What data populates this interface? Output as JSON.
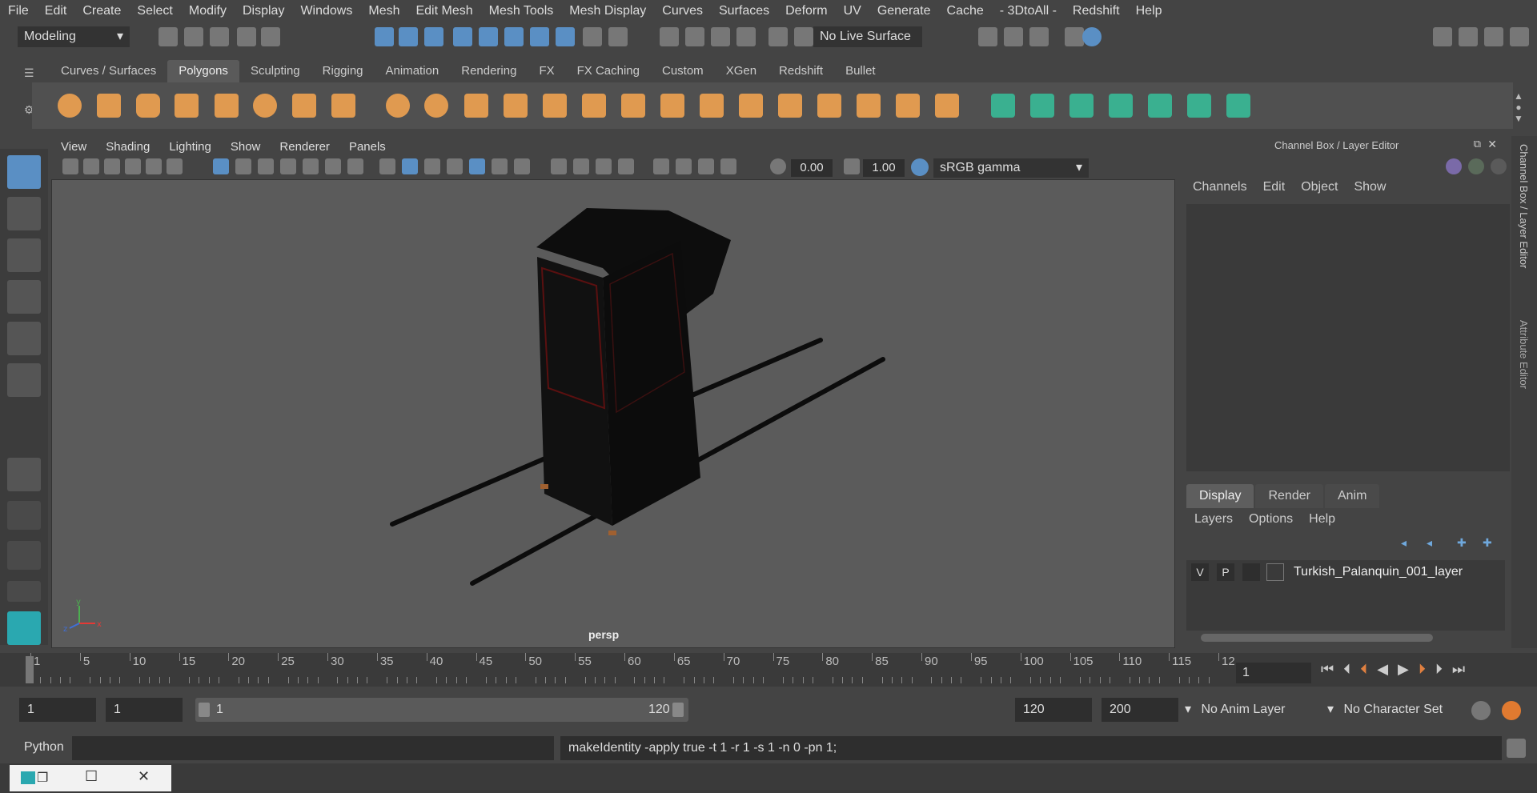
{
  "menubar": [
    "File",
    "Edit",
    "Create",
    "Select",
    "Modify",
    "Display",
    "Windows",
    "Mesh",
    "Edit Mesh",
    "Mesh Tools",
    "Mesh Display",
    "Curves",
    "Surfaces",
    "Deform",
    "UV",
    "Generate",
    "Cache",
    "- 3DtoAll -",
    "Redshift",
    "Help"
  ],
  "status": {
    "mode": "Modeling",
    "live_surface": "No Live Surface"
  },
  "shelf_tabs": [
    {
      "label": "Curves / Surfaces",
      "active": false
    },
    {
      "label": "Polygons",
      "active": true
    },
    {
      "label": "Sculpting",
      "active": false
    },
    {
      "label": "Rigging",
      "active": false
    },
    {
      "label": "Animation",
      "active": false
    },
    {
      "label": "Rendering",
      "active": false
    },
    {
      "label": "FX",
      "active": false
    },
    {
      "label": "FX Caching",
      "active": false
    },
    {
      "label": "Custom",
      "active": false
    },
    {
      "label": "XGen",
      "active": false
    },
    {
      "label": "Redshift",
      "active": false
    },
    {
      "label": "Bullet",
      "active": false
    }
  ],
  "viewport": {
    "menu": [
      "View",
      "Shading",
      "Lighting",
      "Show",
      "Renderer",
      "Panels"
    ],
    "exposure": "0.00",
    "gamma": "1.00",
    "color_space": "sRGB gamma",
    "camera": "persp",
    "axis_y": "y",
    "axis_x": "x",
    "axis_z": "z"
  },
  "channel_box": {
    "title": "Channel Box / Layer Editor",
    "menu": [
      "Channels",
      "Edit",
      "Object",
      "Show"
    ]
  },
  "side_tabs": {
    "channel": "Channel Box / Layer Editor",
    "attr": "Attribute Editor"
  },
  "layer_editor": {
    "tabs": [
      {
        "label": "Display",
        "active": true
      },
      {
        "label": "Render",
        "active": false
      },
      {
        "label": "Anim",
        "active": false
      }
    ],
    "menu": [
      "Layers",
      "Options",
      "Help"
    ],
    "layer": {
      "v": "V",
      "p": "P",
      "name": "Turkish_Palanquin_001_layer"
    }
  },
  "timeline": {
    "ticks": [
      "1",
      "5",
      "10",
      "15",
      "20",
      "25",
      "30",
      "35",
      "40",
      "45",
      "50",
      "55",
      "60",
      "65",
      "70",
      "75",
      "80",
      "85",
      "90",
      "95",
      "100",
      "105",
      "110",
      "115",
      "12"
    ],
    "current_frame": "1"
  },
  "range": {
    "start": "1",
    "start2": "1",
    "slider_start": "1",
    "slider_end": "120",
    "end": "120",
    "end2": "200",
    "anim_layer": "No Anim Layer",
    "char_set": "No Character Set"
  },
  "command": {
    "lang": "Python",
    "text": "makeIdentity -apply true -t 1 -r 1 -s 1 -n 0 -pn 1;"
  },
  "colors": {
    "accent": "#5a8fc4",
    "shelf_icon": "#e09a50",
    "teal": "#3ab090",
    "panel": "#444444"
  }
}
